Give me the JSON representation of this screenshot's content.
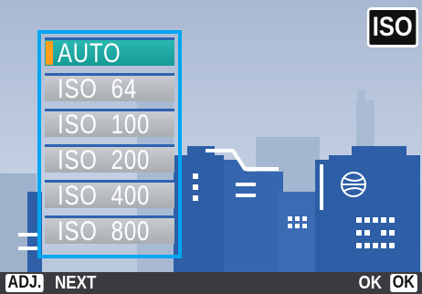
{
  "mode_badge": "ISO",
  "menu": {
    "items": [
      {
        "label": "AUTO",
        "selected": true
      },
      {
        "label": "ISO  64",
        "selected": false
      },
      {
        "label": "ISO  100",
        "selected": false
      },
      {
        "label": "ISO  200",
        "selected": false
      },
      {
        "label": "ISO  400",
        "selected": false
      },
      {
        "label": "ISO  800",
        "selected": false
      }
    ]
  },
  "bottom_bar": {
    "adj_key": "ADJ.",
    "next_label": "NEXT",
    "ok_label": "OK",
    "ok_key": "OK"
  },
  "colors": {
    "frame": "#00a6f2",
    "selected_item": "#169a96",
    "cursor": "#ff9e1b",
    "sky": "#bcc9de"
  }
}
